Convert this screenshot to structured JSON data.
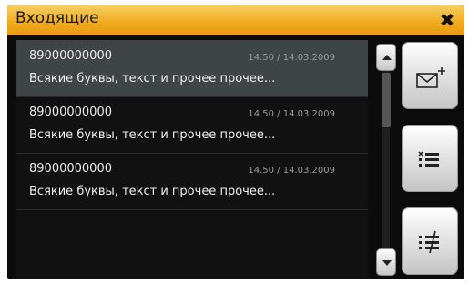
{
  "window": {
    "title": "Входящие",
    "close_glyph": "✖"
  },
  "messages": [
    {
      "phone": "89000000000",
      "time": "14.50 / 14.03.2009",
      "text": "Всякие буквы, текст и прочее прочее...",
      "selected": true
    },
    {
      "phone": "89000000000",
      "time": "14.50 / 14.03.2009",
      "text": "Всякие буквы, текст и прочее прочее...",
      "selected": false
    },
    {
      "phone": "89000000000",
      "time": "14.50 / 14.03.2009",
      "text": "Всякие буквы, текст и прочее прочее...",
      "selected": false
    }
  ],
  "actions": {
    "new_message_icon": "envelope-plus-icon",
    "delete_selected_icon": "list-x-icon",
    "delete_all_icon": "list-strike-icon"
  },
  "colors": {
    "titlebar": "#f0a91c",
    "background": "#0b0b0b",
    "selected_row": "#3f4447"
  }
}
